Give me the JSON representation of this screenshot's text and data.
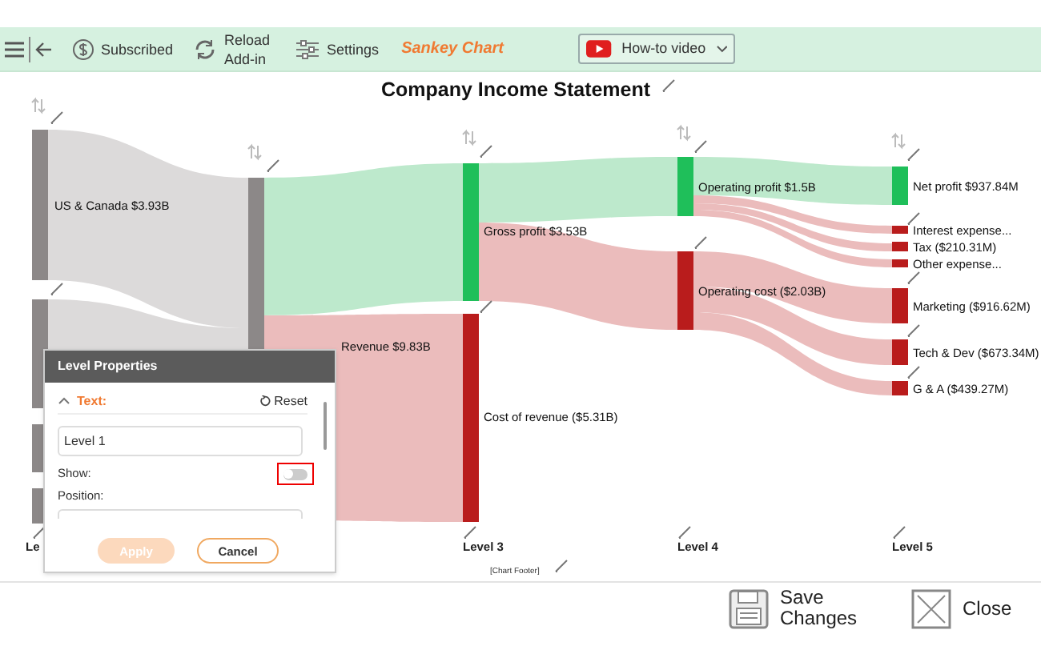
{
  "toolbar": {
    "items": [
      {
        "kind": "subscribed",
        "label": "Subscribed"
      },
      {
        "kind": "reload",
        "label": "Reload Add-in"
      },
      {
        "kind": "settings",
        "label": "Settings"
      }
    ],
    "app_title": "Sankey Chart",
    "video_button": "How-to video"
  },
  "chart": {
    "title": "Company Income Statement",
    "nodes": [
      {
        "label": "US & Canada $3.93B",
        "color": "#8c8888"
      },
      {
        "color": "#8c8888"
      },
      {
        "color": "#8c8888"
      },
      {
        "color": "#8c8888"
      },
      {
        "label": "Revenue $9.83B",
        "color": "#8c8888"
      },
      {
        "label": "Gross profit $3.53B",
        "color": "#1fbf5a"
      },
      {
        "label": "Cost of revenue ($5.31B)",
        "color": "#b91c1c"
      },
      {
        "label": "Operating profit $1.5B",
        "color": "#1fbf5a"
      },
      {
        "label": "Operating cost ($2.03B)",
        "color": "#b91c1c"
      },
      {
        "label": "Net profit $937.84M",
        "color": "#1fbf5a"
      },
      {
        "label": "Interest expense...",
        "color": "#b91c1c"
      },
      {
        "label": "Tax ($210.31M)",
        "color": "#b91c1c"
      },
      {
        "label": "Other expense...",
        "color": "#b91c1c"
      },
      {
        "label": "Marketing ($916.62M)",
        "color": "#b91c1c"
      },
      {
        "label": "Tech & Dev ($673.34M)",
        "color": "#b91c1c"
      },
      {
        "label": "G & A ($439.27M)",
        "color": "#b91c1c"
      }
    ],
    "level_labels": [
      "Le",
      "Level 3",
      "Level 4",
      "Level 5"
    ],
    "footer": "[Chart Footer]"
  },
  "panel": {
    "title": "Level Properties",
    "section": "Text:",
    "expanded": true,
    "reset": "Reset",
    "text_value": "Level 1",
    "show": {
      "label": "Show:",
      "on": false
    },
    "position_label": "Position:",
    "apply": {
      "label": "Apply",
      "disabled": true
    },
    "cancel": "Cancel"
  },
  "footer_buttons": [
    {
      "kind": "save",
      "label": "Save Changes"
    },
    {
      "kind": "close",
      "label": "Close"
    }
  ]
}
